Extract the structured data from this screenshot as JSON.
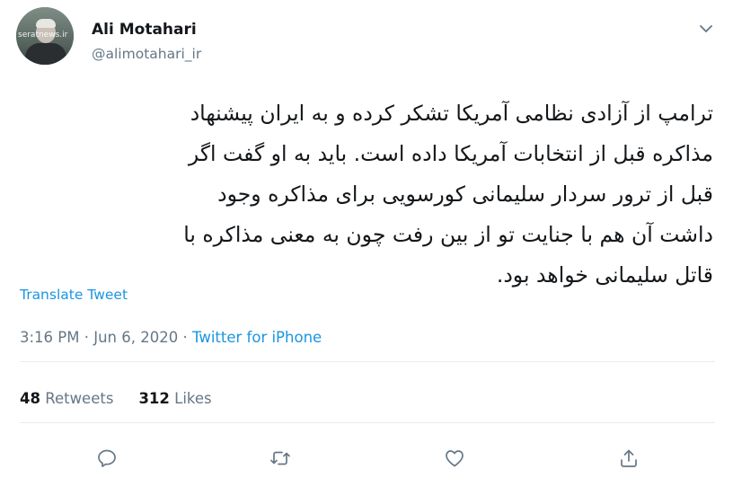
{
  "user": {
    "name": "Ali Motahari",
    "handle": "@alimotahari_ir",
    "avatar_watermark_top": "SeratNews",
    "avatar_watermark_bottom": "seratnews.ir"
  },
  "tweet": {
    "lines": [
      "ترامپ از آزادی نظامی آمریکا تشکر کرده و به ایران پیشنهاد",
      "مذاکره قبل از انتخابات آمریکا داده است. باید به او گفت اگر",
      "قبل از ترور سردار سلیمانی کورسویی برای مذاکره وجود",
      "داشت آن هم با جنایت تو از بین رفت چون به معنی مذاکره با",
      "قاتل سلیمانی خواهد بود."
    ],
    "translate_label": "Translate Tweet"
  },
  "meta": {
    "time": "3:16 PM",
    "separator": "·",
    "date": "Jun 6, 2020",
    "source": "Twitter for iPhone"
  },
  "stats": {
    "retweets_count": "48",
    "retweets_label": "Retweets",
    "likes_count": "312",
    "likes_label": "Likes"
  },
  "actions": {
    "icons": [
      "reply-icon",
      "retweet-icon",
      "like-icon",
      "share-icon"
    ],
    "icon_color": "#657786"
  },
  "colors": {
    "link": "#1b95e0",
    "secondary_text": "#657786",
    "divider": "#e6ecf0"
  }
}
